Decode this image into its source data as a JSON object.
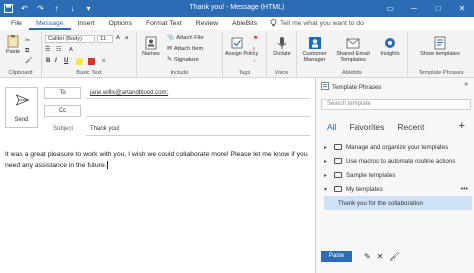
{
  "window": {
    "title": "Thank you!  -  Message (HTML)"
  },
  "menu": {
    "tabs": [
      "File",
      "Message",
      "Insert",
      "Options",
      "Format Text",
      "Review",
      "AbleBits"
    ],
    "tell_me": "Tell me what you want to do"
  },
  "ribbon": {
    "paste_label": "Paste",
    "font_name": "Calibri (Body)",
    "font_size": "11",
    "format_buttons": [
      "B",
      "I",
      "U"
    ],
    "names_label": "Names",
    "attach_file": "Attach File",
    "attach_item": "Attach Item",
    "signature": "Signature",
    "assign_policy": "Assign Policy",
    "dictate": "Dictate",
    "customer_manager": "Customer Manager",
    "shared_email": "Shared Email Templates",
    "insights": "Insights",
    "show_templates": "Show templates",
    "groups": {
      "clipboard": "Clipboard",
      "basic_text": "Basic Text",
      "include": "Include",
      "tags": "Tags",
      "voice": "Voice",
      "ablebits": "Ablebits",
      "template_phrases": "Template Phrases"
    }
  },
  "compose": {
    "send_label": "Send",
    "to_label": "To",
    "cc_label": "Cc",
    "to_value": "jane.willis@artandblood.com;",
    "subject_label": "Subject",
    "subject_value": "Thank you!",
    "body": "It was a great pleasure to work with you, I wish we could collaborate more! Please let me know if you need any assistance in the future."
  },
  "pane": {
    "title": "Template Phrases",
    "search_placeholder": "Search template",
    "tabs": [
      "All",
      "Favorites",
      "Recent"
    ],
    "items": [
      "Manage and organize your templates",
      "Use macros to automate routine actions",
      "Sample templates",
      "My templates",
      "Thank you for the collaboration"
    ],
    "paste_label": "Paste"
  },
  "colors": {
    "accent": "#2b6cb5",
    "selection": "#cfe2f5"
  }
}
